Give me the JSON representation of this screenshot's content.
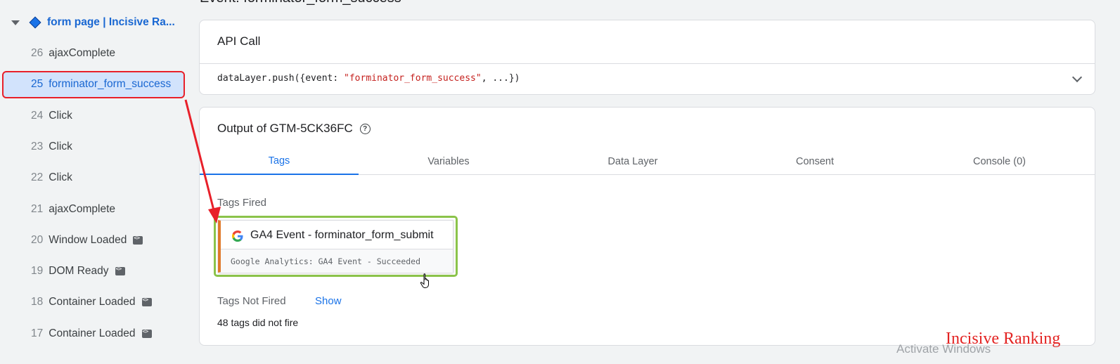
{
  "header": {
    "event_title": "Event: forminator_form_success"
  },
  "sidebar": {
    "page_label": "form page | Incisive Ra...",
    "events": [
      {
        "num": "26",
        "label": "ajaxComplete",
        "code_icon": false,
        "selected": false
      },
      {
        "num": "25",
        "label": "forminator_form_success",
        "code_icon": false,
        "selected": true
      },
      {
        "num": "24",
        "label": "Click",
        "code_icon": false,
        "selected": false
      },
      {
        "num": "23",
        "label": "Click",
        "code_icon": false,
        "selected": false
      },
      {
        "num": "22",
        "label": "Click",
        "code_icon": false,
        "selected": false
      },
      {
        "num": "21",
        "label": "ajaxComplete",
        "code_icon": false,
        "selected": false
      },
      {
        "num": "20",
        "label": "Window Loaded",
        "code_icon": true,
        "selected": false
      },
      {
        "num": "19",
        "label": "DOM Ready",
        "code_icon": true,
        "selected": false
      },
      {
        "num": "18",
        "label": "Container Loaded",
        "code_icon": true,
        "selected": false
      },
      {
        "num": "17",
        "label": "Container Loaded",
        "code_icon": true,
        "selected": false
      }
    ]
  },
  "api_call": {
    "title": "API Call",
    "code_prefix": "dataLayer.push({event: ",
    "code_string": "\"forminator_form_success\"",
    "code_suffix": ", ...})"
  },
  "output": {
    "title": "Output of GTM-5CK36FC",
    "tabs": [
      "Tags",
      "Variables",
      "Data Layer",
      "Consent",
      "Console (0)"
    ],
    "active_tab": "Tags",
    "tags_fired_label": "Tags Fired",
    "fired_tag": {
      "name": "GA4 Event - forminator_form_submit",
      "subtitle": "Google Analytics: GA4 Event - Succeeded",
      "icon": "google-icon"
    },
    "tags_not_fired_label": "Tags Not Fired",
    "show_label": "Show",
    "not_fired_count": "48 tags did not fire"
  },
  "overlay": {
    "windows_watermark": "Activate Windows",
    "brand_watermark": "Incisive Ranking"
  },
  "colors": {
    "accent": "#1a73e8",
    "annotation_red": "#e8202a",
    "highlight_green": "#8bc34a"
  }
}
